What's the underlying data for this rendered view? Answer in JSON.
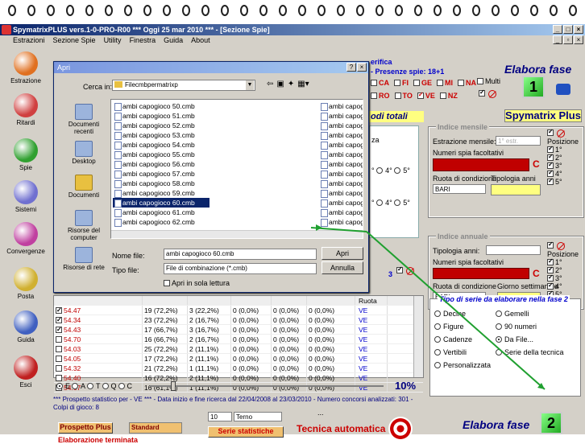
{
  "app": {
    "title": "SpymatrixPLUS vers.1-0-PRO-R00   ***  Oggi 25 mar 2010  ***  - [Sezione Spie]",
    "menu": [
      "Estrazioni",
      "Sezione Spie",
      "Utility",
      "Finestra",
      "Guida",
      "About"
    ],
    "win_buttons": [
      "_",
      "□",
      "×"
    ],
    "mdi_buttons": [
      "_",
      "▫",
      "×"
    ]
  },
  "sidebar": [
    {
      "label": "Estrazione",
      "icon": "pencil-icon",
      "color": "#e07020"
    },
    {
      "label": "Ritardi",
      "icon": "clock-icon",
      "color": "#d04040"
    },
    {
      "label": "Spie",
      "icon": "binoculars-icon",
      "color": "#30a030"
    },
    {
      "label": "Sistemi",
      "icon": "bulb-icon",
      "color": "#7070d0"
    },
    {
      "label": "Convergenze",
      "icon": "convergence-icon",
      "color": "#c040a0"
    },
    {
      "label": "Posta",
      "icon": "coin-icon",
      "color": "#d0b030"
    },
    {
      "label": "Guida",
      "icon": "book-icon",
      "color": "#4060c0"
    },
    {
      "label": "Esci",
      "icon": "power-icon",
      "color": "#c02020"
    }
  ],
  "dialog": {
    "title": "Apri",
    "title_buttons": [
      "?",
      "×"
    ],
    "look_in_label": "Cerca in:",
    "look_in_value": "Filecmbpermatrixp",
    "places": [
      "Documenti recenti",
      "Desktop",
      "Documenti",
      "Risorse del computer",
      "Risorse di rete"
    ],
    "files_col1": [
      "ambi capogioco 50.cmb",
      "ambi capogioco 51.cmb",
      "ambi capogioco 52.cmb",
      "ambi capogioco 53.cmb",
      "ambi capogioco 54.cmb",
      "ambi capogioco 55.cmb",
      "ambi capogioco 56.cmb",
      "ambi capogioco 57.cmb",
      "ambi capogioco 58.cmb",
      "ambi capogioco 59.cmb",
      "ambi capogioco 60.cmb",
      "ambi capogioco 61.cmb",
      "ambi capogioco 62.cmb"
    ],
    "files_col2": [
      "ambi capogi",
      "ambi capogi",
      "ambi capogi",
      "ambi capogi",
      "ambi capogi",
      "ambi capogi",
      "ambi capogi",
      "ambi capogi",
      "ambi capogi",
      "ambi capogi",
      "ambi capogi",
      "ambi capogi",
      "ambi capogi"
    ],
    "selected_file": "ambi capogioco 60.cmb",
    "filename_label": "Nome file:",
    "filename_value": "ambi capogioco 60.cmb",
    "filetype_label": "Tipo file:",
    "filetype_value": "File di combinazione (*.cmb)",
    "readonly_label": "Apri in sola lettura",
    "open_button": "Apri",
    "cancel_button": "Annulla"
  },
  "behind": {
    "header_fragment": "erifica",
    "presenze": "- Presenze spie: 18+1",
    "wheels_row1": [
      "CA",
      "FI",
      "GE",
      "MI",
      "NA"
    ],
    "wheels_row2": [
      "RO",
      "TO",
      "VE",
      "NZ"
    ],
    "multi": "Multi",
    "elabora_fase_top": "Elabora fase",
    "badge1": "1",
    "brand": "Spymatrix Plus",
    "periodi_totali": "odi totali",
    "za": "za",
    "pos_a": [
      "4°",
      "5°"
    ],
    "pos_b": [
      "4°",
      "5°"
    ],
    "num3": "3",
    "ruota_header": "Ruota"
  },
  "indice_mensile": {
    "legend": "Indice mensile",
    "estrazione_label": "Estrazione mensile:",
    "estrazione_value": "1° estr.",
    "numeri_label": "Numeri spia facoltativi",
    "c_letter": "C",
    "ruota_label": "Ruota di condizione",
    "tipologia_label": "Tipologia anni",
    "ruota_value": "BARI",
    "posizione_label": "Posizione",
    "posizioni": [
      "1°",
      "2°",
      "3°",
      "4°",
      "5°"
    ]
  },
  "indice_annuale": {
    "legend": "Indice annuale",
    "tipologia_label": "Tipologia anni:",
    "numeri_label": "Numeri spia facoltativi",
    "c_letter": "C",
    "ruota_label": "Ruota di condizione",
    "giorno_label": "Giorno settimanale",
    "ruota_value": "BARI",
    "posizione_label": "Posizione",
    "posizioni": [
      "1°",
      "2°",
      "3°",
      "4°",
      "5°"
    ]
  },
  "tipo_serie": {
    "legend": "Tipo di serie da elaborare nella fase 2",
    "options": [
      "Decine",
      "Gemelli",
      "Figure",
      "90 numeri",
      "Cadenze",
      "Da File...",
      "Vertibili",
      "Serie della tecnica",
      "Personalizzata"
    ],
    "selected": "Da File..."
  },
  "table": {
    "rows": [
      {
        "num": "54.47",
        "c2": "19 (72,2%)",
        "c3": "3 (22,2%)",
        "c4": "0 (0,0%)",
        "c5": "0 (0,0%)",
        "c6": "0 (0,0%)",
        "ruota": "VE",
        "checked": true
      },
      {
        "num": "54.34",
        "c2": "23 (72,2%)",
        "c3": "2 (16,7%)",
        "c4": "0 (0,0%)",
        "c5": "0 (0,0%)",
        "c6": "0 (0,0%)",
        "ruota": "VE",
        "checked": true
      },
      {
        "num": "54.43",
        "c2": "17 (66,7%)",
        "c3": "3 (16,7%)",
        "c4": "0 (0,0%)",
        "c5": "0 (0,0%)",
        "c6": "0 (0,0%)",
        "ruota": "VE",
        "checked": true
      },
      {
        "num": "54.70",
        "c2": "16 (66,7%)",
        "c3": "2 (16,7%)",
        "c4": "0 (0,0%)",
        "c5": "0 (0,0%)",
        "c6": "0 (0,0%)",
        "ruota": "VE",
        "checked": false
      },
      {
        "num": "54.03",
        "c2": "25 (72,2%)",
        "c3": "2 (11,1%)",
        "c4": "0 (0,0%)",
        "c5": "0 (0,0%)",
        "c6": "0 (0,0%)",
        "ruota": "VE",
        "checked": false
      },
      {
        "num": "54.05",
        "c2": "17 (72,2%)",
        "c3": "2 (11,1%)",
        "c4": "0 (0,0%)",
        "c5": "0 (0,0%)",
        "c6": "0 (0,0%)",
        "ruota": "VE",
        "checked": false
      },
      {
        "num": "54.32",
        "c2": "21 (72,2%)",
        "c3": "1 (11,1%)",
        "c4": "0 (0,0%)",
        "c5": "0 (0,0%)",
        "c6": "0 (0,0%)",
        "ruota": "VE",
        "checked": false
      },
      {
        "num": "54.40",
        "c2": "16 (72,2%)",
        "c3": "2 (11,1%)",
        "c4": "0 (0,0%)",
        "c5": "0 (0,0%)",
        "c6": "0 (0,0%)",
        "ruota": "VE",
        "checked": false
      },
      {
        "num": "54.67",
        "c2": "16 (61,1%)",
        "c3": "1 (11,1%)",
        "c4": "0 (0,0%)",
        "c5": "0 (0,0%)",
        "c6": "0 (0,0%)",
        "ruota": "VE",
        "checked": false
      }
    ]
  },
  "slider": {
    "options": [
      "E",
      "A",
      "T",
      "Q",
      "C"
    ],
    "percent": "10%",
    "level": 0.1
  },
  "status_text": "*** Prospetto statistico per  - VE *** - Data inizio e fine ricerca dal 22/04/2008 al 23/03/2010 - Numero concorsi analizzati: 301 - Colpi di gioco: 8",
  "bottom": {
    "prospetto_button": "Prospetto Plus",
    "standard_value": "Standard",
    "elaborazione": "Elaborazione terminata",
    "num_value": "10",
    "terno_value": "Terno",
    "ellipsis": "...",
    "serie_button": "Serie statistiche",
    "tecnica": "Tecnica automatica",
    "elabora_fase_bottom": "Elabora fase",
    "badge2": "2"
  },
  "colors": {
    "accent_red": "#c00000",
    "title_blue": "#0a246a",
    "arrow_green": "#20a030",
    "yellow_panel": "#ffff80"
  }
}
